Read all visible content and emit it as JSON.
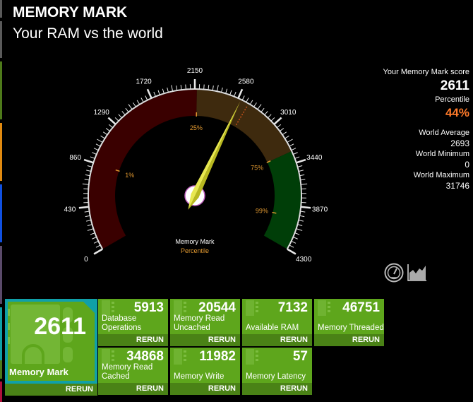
{
  "header": {
    "title": "MEMORY MARK",
    "subtitle": "Your RAM vs the world"
  },
  "side_strip_colors": [
    "#5a5a5a",
    "#5a5a5a",
    "#4e7a1a",
    "#e08a10",
    "#1050e0",
    "#5a4a6a",
    "#10a0a8",
    "#4e7a1a",
    "#b0103a"
  ],
  "gauge": {
    "min": 0,
    "max": 4300,
    "tick_labels": [
      "0",
      "430",
      "860",
      "1290",
      "1720",
      "2150",
      "2580",
      "3010",
      "3440",
      "3870",
      "4300"
    ],
    "value": 2611,
    "world_average": 2693,
    "center_label": "Memory Mark",
    "center_sublabel": "Percentile",
    "bands": [
      {
        "from": 0,
        "to": 2170,
        "color": "#3a0000"
      },
      {
        "from": 2170,
        "to": 3320,
        "color": "#3e2a0e"
      },
      {
        "from": 3320,
        "to": 4300,
        "color": "#003e08"
      }
    ],
    "percentile_markers": [
      {
        "label": "1%",
        "value": 860
      },
      {
        "label": "25%",
        "value": 2170
      },
      {
        "label": "75%",
        "value": 3320
      },
      {
        "label": "99%",
        "value": 3980
      }
    ],
    "needle_color": "#e0e040",
    "label_color": "#e09830"
  },
  "stats": {
    "score_label": "Your Memory Mark score",
    "score": "2611",
    "percentile_label": "Percentile",
    "percentile": "44%",
    "world_average_label": "World Average",
    "world_average": "2693",
    "world_minimum_label": "World Minimum",
    "world_minimum": "0",
    "world_maximum_label": "World Maximum",
    "world_maximum": "31746"
  },
  "icons": {
    "gauge_view": "speedometer-icon",
    "chart_view": "area-chart-icon"
  },
  "main_tile": {
    "score": "2611",
    "label": "Memory Mark",
    "rerun": "RERUN"
  },
  "tiles": [
    {
      "value": "5913",
      "label_line1": "Database",
      "label_line2": "Operations",
      "rerun": "RERUN"
    },
    {
      "value": "20544",
      "label_line1": "Memory Read",
      "label_line2": "Uncached",
      "rerun": "RERUN"
    },
    {
      "value": "7132",
      "label_line1": "",
      "label_line2": "Available RAM",
      "rerun": "RERUN"
    },
    {
      "value": "46751",
      "label_line1": "",
      "label_line2": "Memory Threaded",
      "rerun": "RERUN"
    },
    {
      "value": "34868",
      "label_line1": "Memory Read",
      "label_line2": "Cached",
      "rerun": "RERUN"
    },
    {
      "value": "11982",
      "label_line1": "",
      "label_line2": "Memory Write",
      "rerun": "RERUN"
    },
    {
      "value": "57",
      "label_line1": "",
      "label_line2": "Memory Latency",
      "rerun": "RERUN"
    }
  ]
}
